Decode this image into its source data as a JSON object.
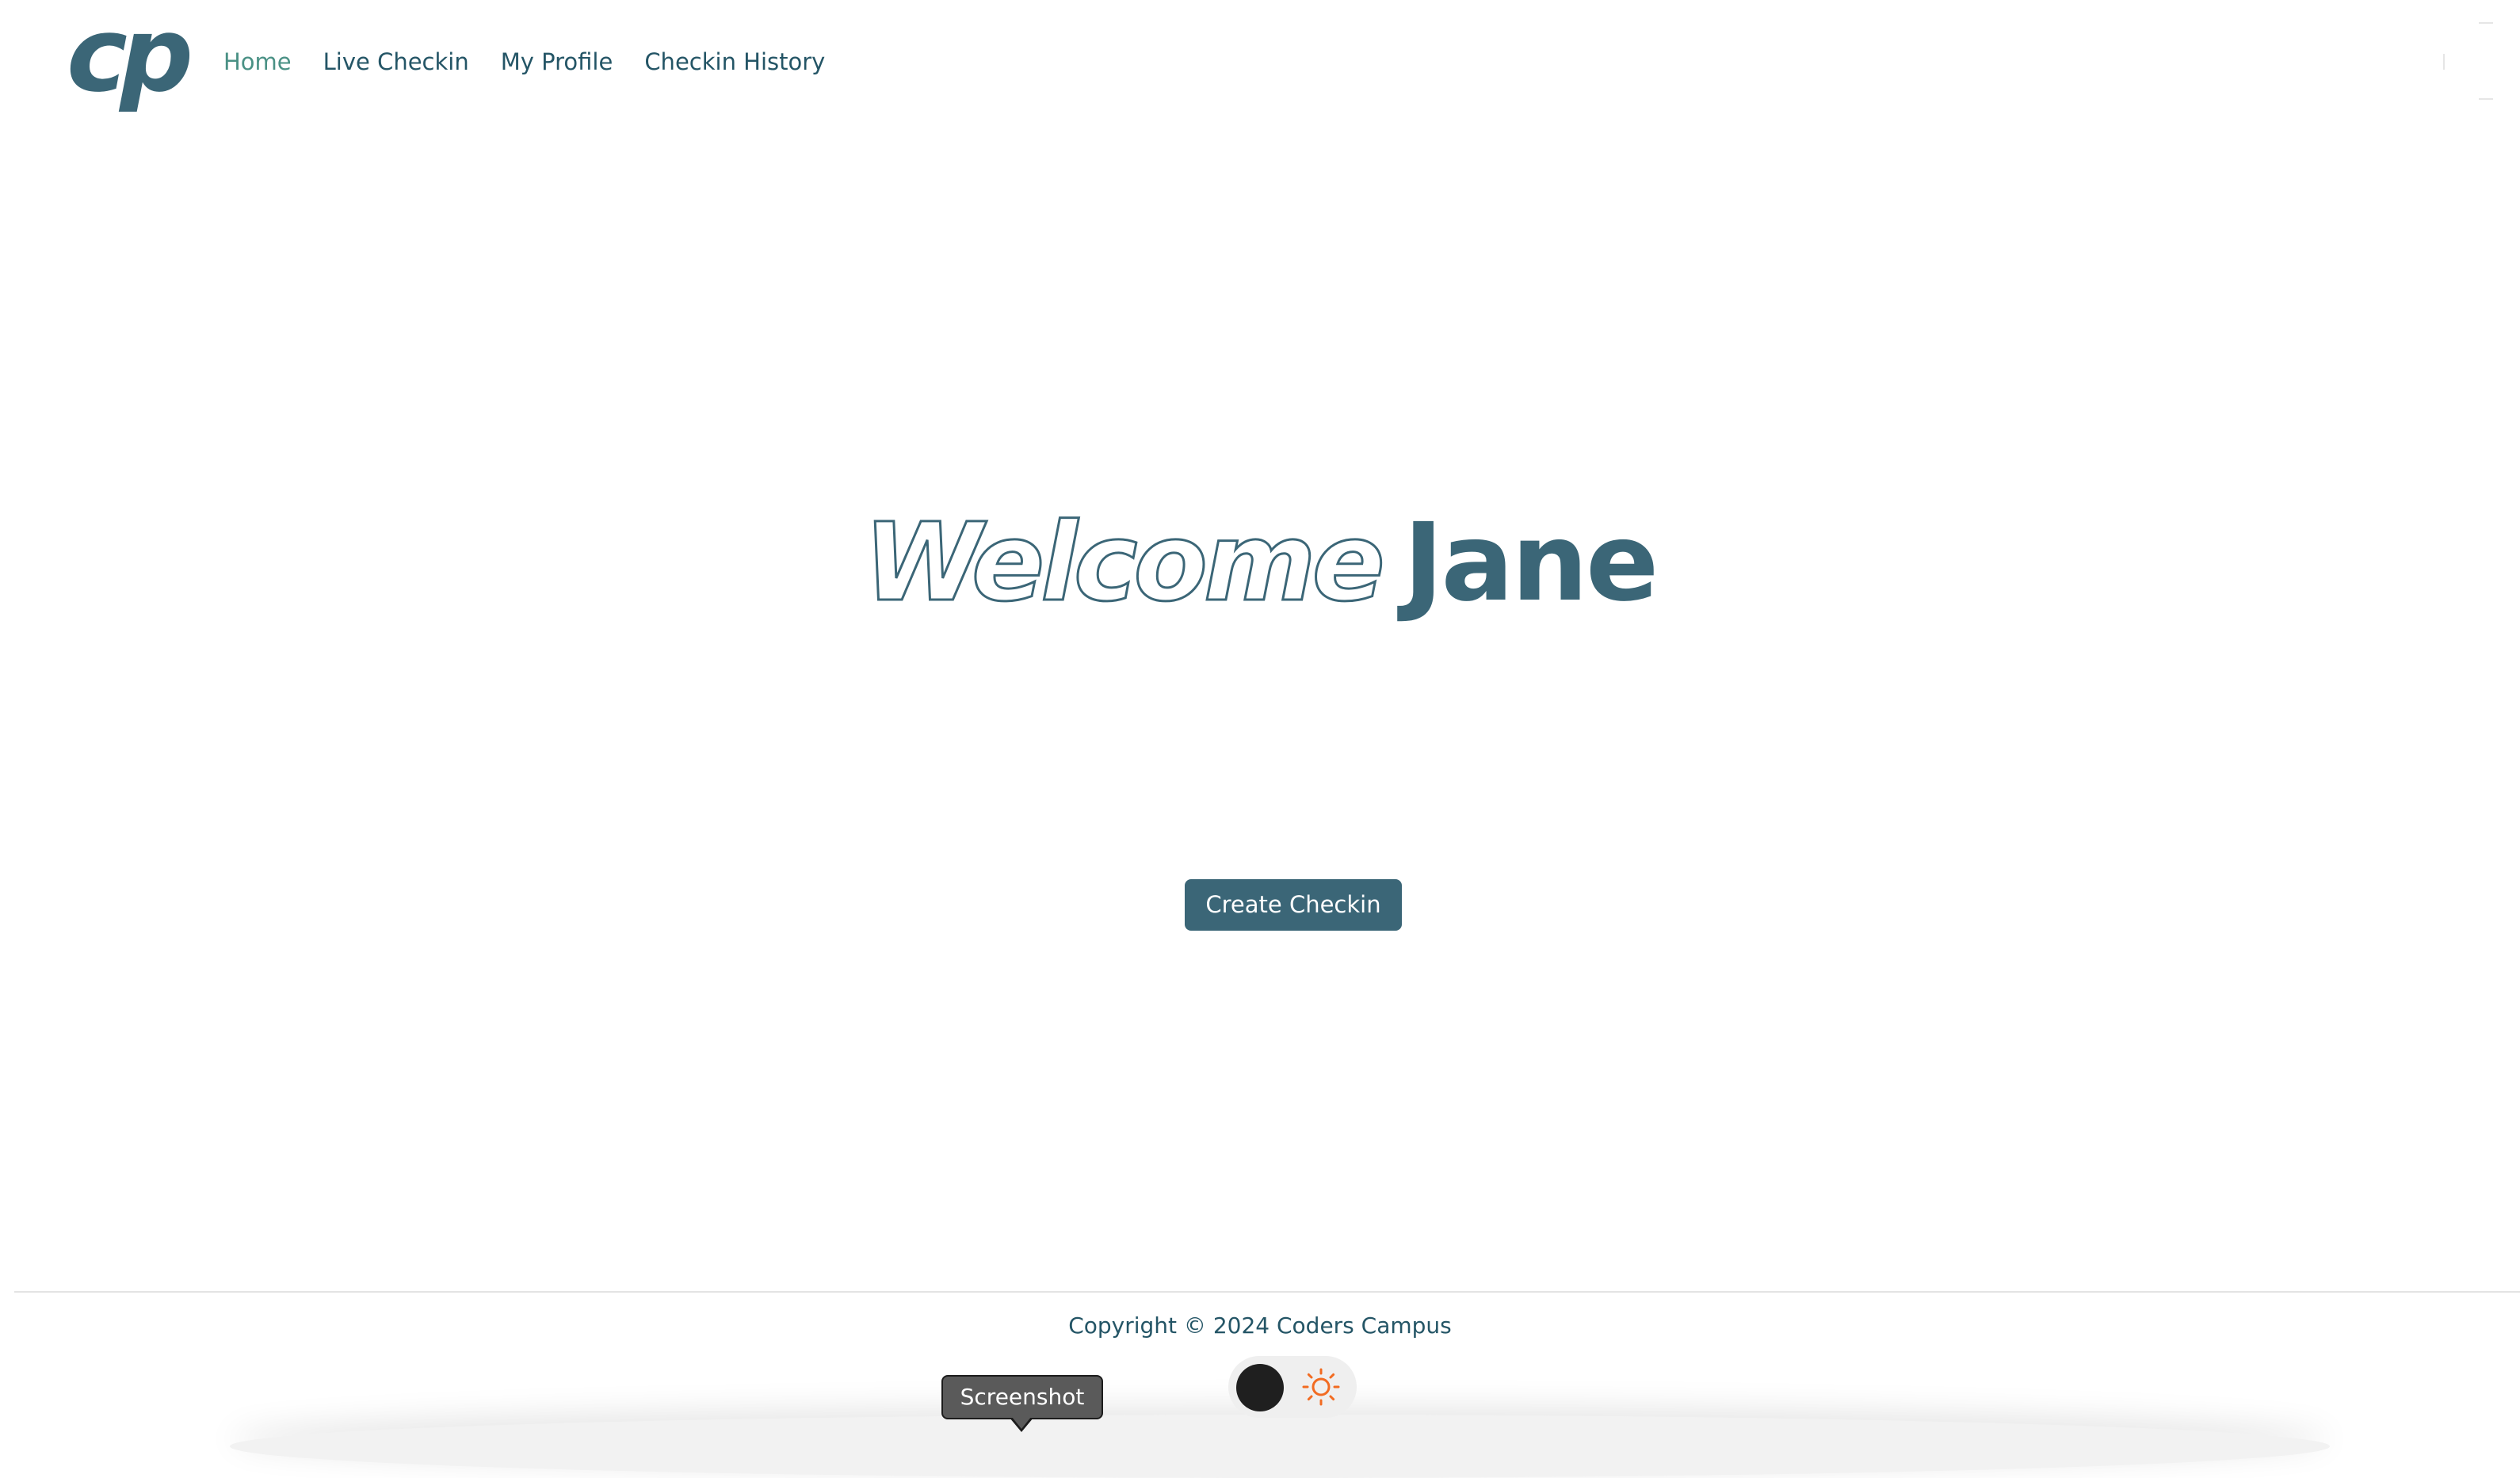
{
  "header": {
    "logo_text": "cp",
    "nav": {
      "items": [
        {
          "label": "Home",
          "active": true
        },
        {
          "label": "Live Checkin",
          "active": false
        },
        {
          "label": "My Profile",
          "active": false
        },
        {
          "label": "Checkin History",
          "active": false
        }
      ]
    }
  },
  "hero": {
    "welcome": "Welcome",
    "name": "Jane"
  },
  "cta": {
    "label": "Create Checkin"
  },
  "footer": {
    "copyright": "Copyright © 2024 Coders Campus"
  },
  "theme_toggle": {
    "icon": "sun-icon",
    "mode": "light"
  },
  "tooltip": {
    "label": "Screenshot"
  },
  "colors": {
    "brand": "#3b6677",
    "nav_text": "#245566",
    "nav_active": "#4a9185",
    "toggle_bg": "#efefef",
    "sun": "#f26b21"
  }
}
